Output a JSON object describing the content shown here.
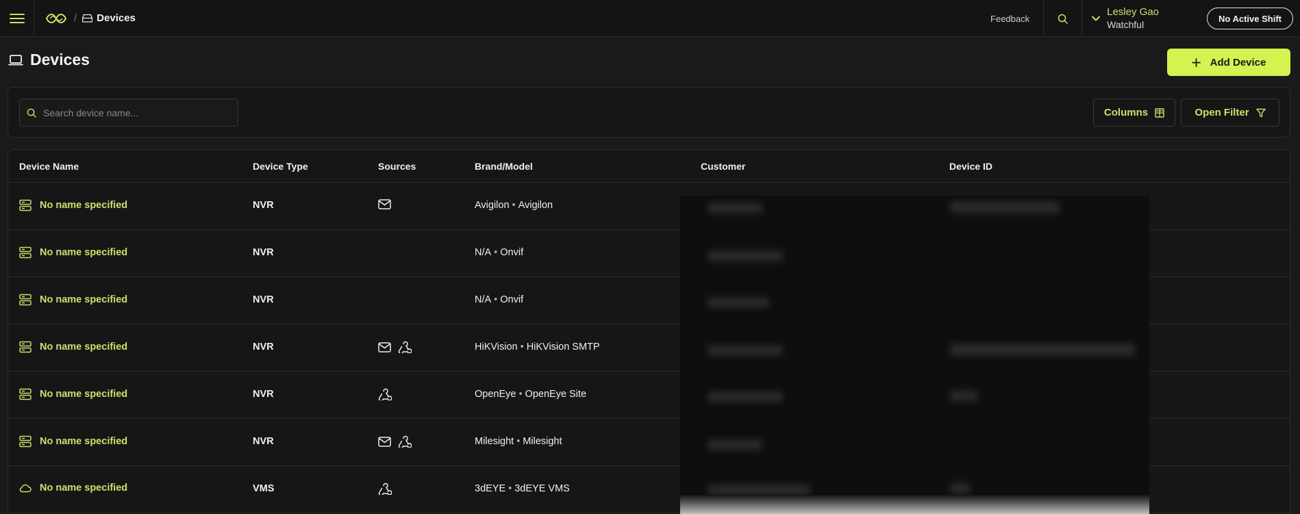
{
  "topbar": {
    "breadcrumb_title": "Devices",
    "feedback_label": "Feedback",
    "user_name": "Lesley Gao",
    "user_org": "Watchful",
    "shift_label": "No Active Shift"
  },
  "page": {
    "title": "Devices",
    "add_label": "Add Device"
  },
  "filters": {
    "search_placeholder": "Search device name...",
    "columns_label": "Columns",
    "filter_label": "Open Filter"
  },
  "table": {
    "headers": [
      "Device Name",
      "Device Type",
      "Sources",
      "Brand/Model",
      "Customer",
      "Device ID"
    ],
    "rows": [
      {
        "name": "No name specified",
        "icon": "server-icon",
        "type": "NVR",
        "sources": [
          "mail-icon"
        ],
        "brand": "Avigilon",
        "model": "Avigilon"
      },
      {
        "name": "No name specified",
        "icon": "server-icon",
        "type": "NVR",
        "sources": [],
        "brand": "N/A",
        "model": "Onvif"
      },
      {
        "name": "No name specified",
        "icon": "server-icon",
        "type": "NVR",
        "sources": [],
        "brand": "N/A",
        "model": "Onvif"
      },
      {
        "name": "No name specified",
        "icon": "server-icon",
        "type": "NVR",
        "sources": [
          "mail-icon",
          "webhook-icon"
        ],
        "brand": "HiKVision",
        "model": "HiKVision SMTP"
      },
      {
        "name": "No name specified",
        "icon": "server-icon",
        "type": "NVR",
        "sources": [
          "webhook-icon"
        ],
        "brand": "OpenEye",
        "model": "OpenEye Site"
      },
      {
        "name": "No name specified",
        "icon": "server-icon",
        "type": "NVR",
        "sources": [
          "mail-icon",
          "webhook-icon"
        ],
        "brand": "Milesight",
        "model": "Milesight"
      },
      {
        "name": "No name specified",
        "icon": "cloud-icon",
        "type": "VMS",
        "sources": [
          "webhook-icon"
        ],
        "brand": "3dEYE",
        "model": "3dEYE VMS"
      }
    ]
  },
  "colors": {
    "accent": "#c8e26a",
    "button": "#d4f250",
    "background": "#1a1a1a"
  }
}
